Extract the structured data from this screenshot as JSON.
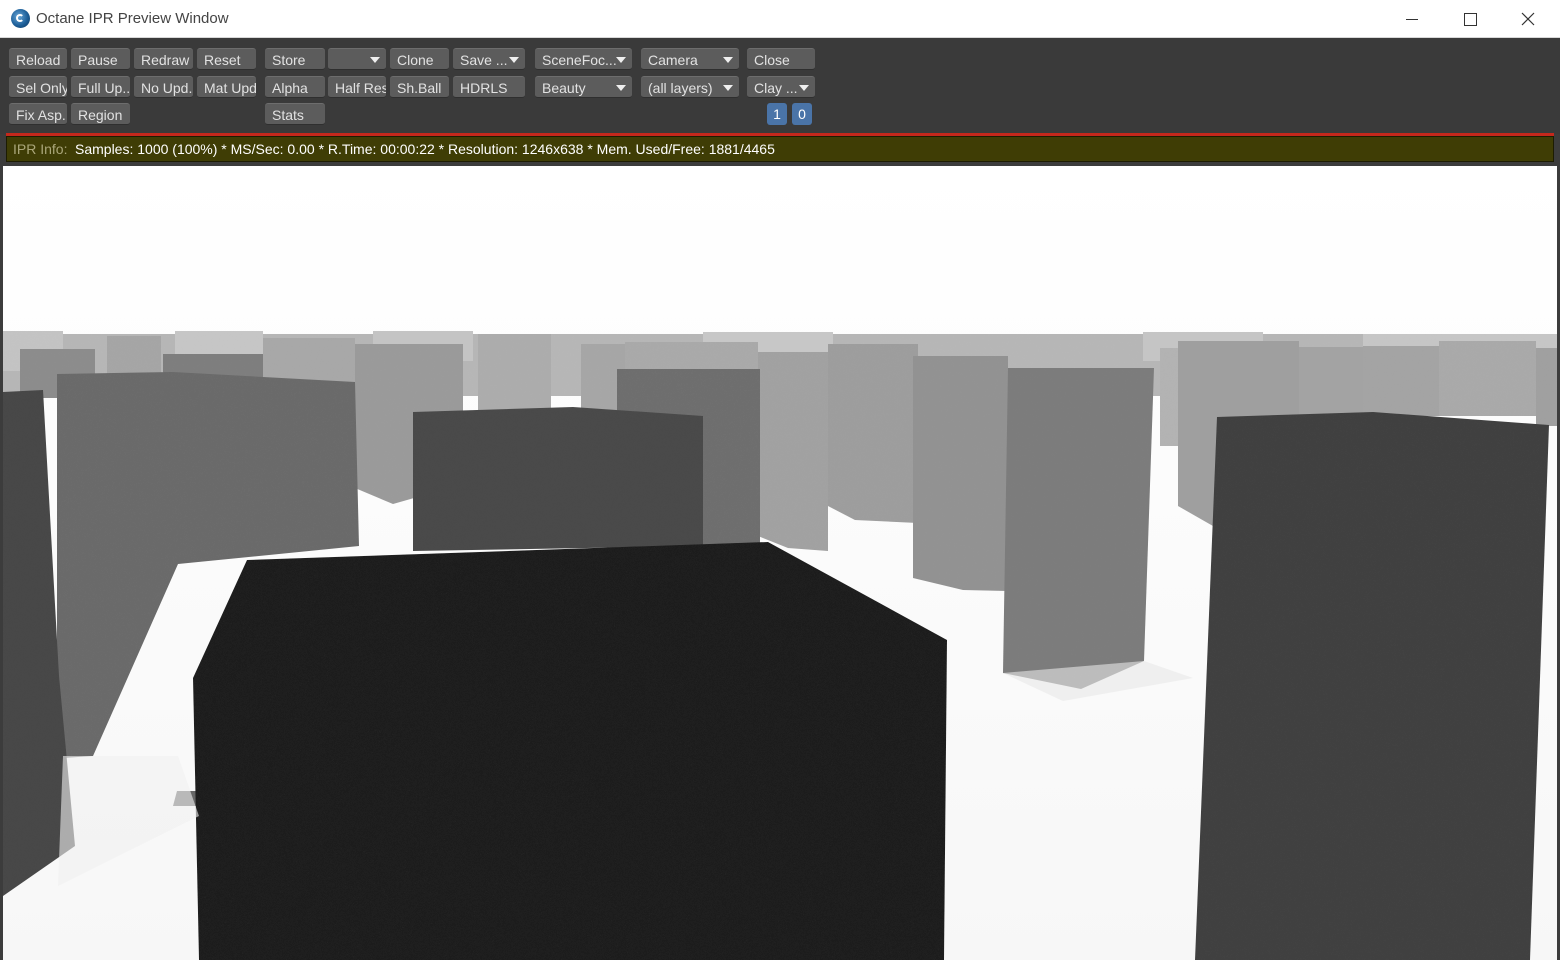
{
  "window": {
    "title": "Octane IPR Preview Window"
  },
  "toolbar": {
    "reload": "Reload",
    "pause": "Pause",
    "redraw": "Redraw",
    "reset": "Reset",
    "store": "Store",
    "store_slot": "",
    "clone": "Clone",
    "save": "Save ...",
    "scene_focus": "SceneFoc...",
    "camera": "Camera",
    "close": "Close",
    "sel_only": "Sel Only",
    "full_update": "Full Up...",
    "no_update": "No Upd.",
    "mat_update": "Mat Upd",
    "alpha": "Alpha",
    "half_res": "Half Res",
    "sh_ball": "Sh.Ball",
    "hdrls": "HDRLS",
    "render_pass": "Beauty",
    "layers": "(all layers)",
    "clay": "Clay ...",
    "fix_aspect": "Fix Asp.",
    "region": "Region",
    "stats": "Stats",
    "num_1": "1",
    "num_0": "0"
  },
  "status": {
    "label": "IPR Info:",
    "text": "Samples: 1000 (100%)  *  MS/Sec: 0.00  *  R.Time: 00:00:22  *  Resolution: 1246x638  *  Mem. Used/Free: 1881/4465"
  },
  "icons": {
    "app": "octane-app-icon",
    "minimize": "minimize-icon",
    "maximize": "maximize-icon",
    "close": "close-icon",
    "dropdown": "chevron-down-icon"
  },
  "colors": {
    "status_bar": "#3f3d05",
    "progress_red": "#c4281c",
    "accent_blue": "#4a74a8"
  }
}
